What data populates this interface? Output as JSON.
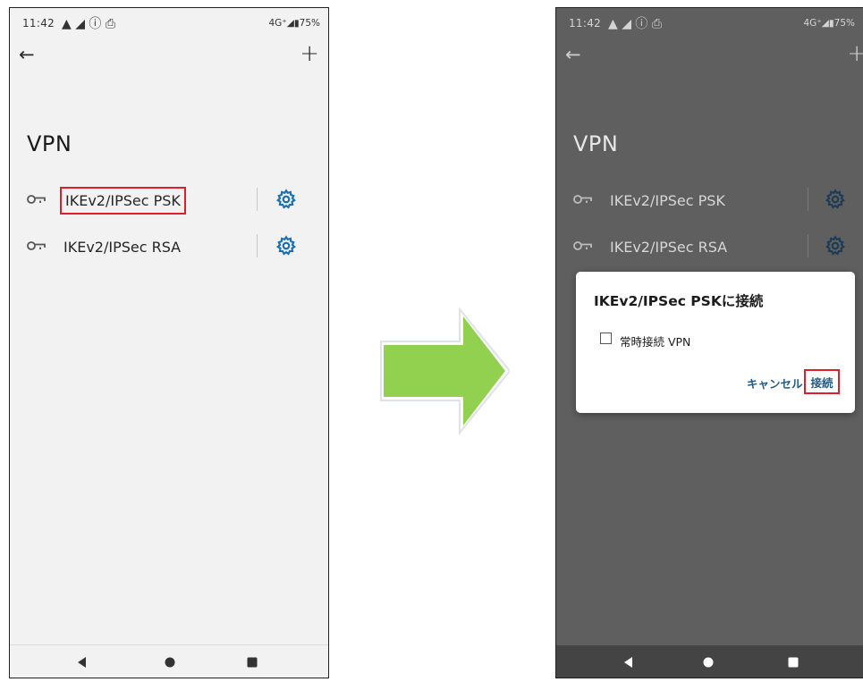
{
  "before": {
    "status": {
      "time": "11:42",
      "icons": "▲ ◢ ⓘ ⎙",
      "signal": "4G⁺◢▮75%"
    },
    "back_icon": "←",
    "add_icon": "+",
    "title": "VPN",
    "items": [
      {
        "label": "IKEv2/IPSec PSK",
        "highlighted": true
      },
      {
        "label": "IKEv2/IPSec RSA",
        "highlighted": false
      }
    ]
  },
  "after": {
    "status": {
      "time": "11:42",
      "icons": "▲ ◢ ⓘ ⎙",
      "signal": "4G⁺◢▮75%"
    },
    "back_icon": "←",
    "add_icon": "+",
    "title": "VPN",
    "items": [
      {
        "label": "IKEv2/IPSec PSK"
      },
      {
        "label": "IKEv2/IPSec RSA"
      }
    ],
    "dialog": {
      "title": "IKEv2/IPSec PSKに接続",
      "checkbox_label": "常時接続 VPN",
      "checkbox_checked": false,
      "cancel_label": "キャンセル",
      "connect_label": "接続"
    }
  },
  "colors": {
    "highlight": "#e01e2b",
    "arrow": "#92d050",
    "accent": "#1f5c8c"
  }
}
